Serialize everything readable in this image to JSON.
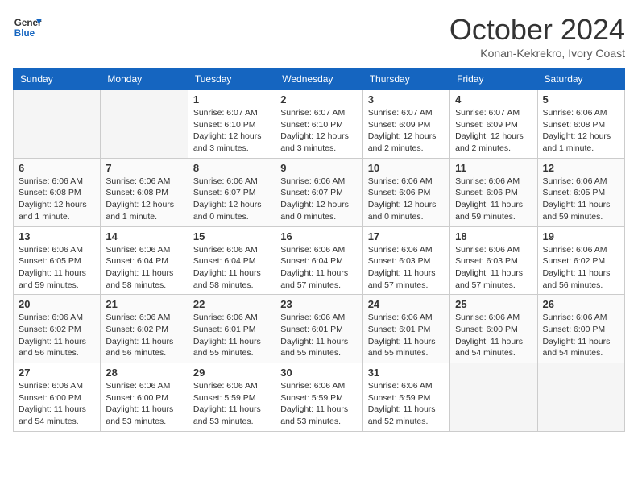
{
  "header": {
    "logo_line1": "General",
    "logo_line2": "Blue",
    "month": "October 2024",
    "location": "Konan-Kekrekro, Ivory Coast"
  },
  "weekdays": [
    "Sunday",
    "Monday",
    "Tuesday",
    "Wednesday",
    "Thursday",
    "Friday",
    "Saturday"
  ],
  "weeks": [
    [
      {
        "day": "",
        "info": ""
      },
      {
        "day": "",
        "info": ""
      },
      {
        "day": "1",
        "info": "Sunrise: 6:07 AM\nSunset: 6:10 PM\nDaylight: 12 hours and 3 minutes."
      },
      {
        "day": "2",
        "info": "Sunrise: 6:07 AM\nSunset: 6:10 PM\nDaylight: 12 hours and 3 minutes."
      },
      {
        "day": "3",
        "info": "Sunrise: 6:07 AM\nSunset: 6:09 PM\nDaylight: 12 hours and 2 minutes."
      },
      {
        "day": "4",
        "info": "Sunrise: 6:07 AM\nSunset: 6:09 PM\nDaylight: 12 hours and 2 minutes."
      },
      {
        "day": "5",
        "info": "Sunrise: 6:06 AM\nSunset: 6:08 PM\nDaylight: 12 hours and 1 minute."
      }
    ],
    [
      {
        "day": "6",
        "info": "Sunrise: 6:06 AM\nSunset: 6:08 PM\nDaylight: 12 hours and 1 minute."
      },
      {
        "day": "7",
        "info": "Sunrise: 6:06 AM\nSunset: 6:08 PM\nDaylight: 12 hours and 1 minute."
      },
      {
        "day": "8",
        "info": "Sunrise: 6:06 AM\nSunset: 6:07 PM\nDaylight: 12 hours and 0 minutes."
      },
      {
        "day": "9",
        "info": "Sunrise: 6:06 AM\nSunset: 6:07 PM\nDaylight: 12 hours and 0 minutes."
      },
      {
        "day": "10",
        "info": "Sunrise: 6:06 AM\nSunset: 6:06 PM\nDaylight: 12 hours and 0 minutes."
      },
      {
        "day": "11",
        "info": "Sunrise: 6:06 AM\nSunset: 6:06 PM\nDaylight: 11 hours and 59 minutes."
      },
      {
        "day": "12",
        "info": "Sunrise: 6:06 AM\nSunset: 6:05 PM\nDaylight: 11 hours and 59 minutes."
      }
    ],
    [
      {
        "day": "13",
        "info": "Sunrise: 6:06 AM\nSunset: 6:05 PM\nDaylight: 11 hours and 59 minutes."
      },
      {
        "day": "14",
        "info": "Sunrise: 6:06 AM\nSunset: 6:04 PM\nDaylight: 11 hours and 58 minutes."
      },
      {
        "day": "15",
        "info": "Sunrise: 6:06 AM\nSunset: 6:04 PM\nDaylight: 11 hours and 58 minutes."
      },
      {
        "day": "16",
        "info": "Sunrise: 6:06 AM\nSunset: 6:04 PM\nDaylight: 11 hours and 57 minutes."
      },
      {
        "day": "17",
        "info": "Sunrise: 6:06 AM\nSunset: 6:03 PM\nDaylight: 11 hours and 57 minutes."
      },
      {
        "day": "18",
        "info": "Sunrise: 6:06 AM\nSunset: 6:03 PM\nDaylight: 11 hours and 57 minutes."
      },
      {
        "day": "19",
        "info": "Sunrise: 6:06 AM\nSunset: 6:02 PM\nDaylight: 11 hours and 56 minutes."
      }
    ],
    [
      {
        "day": "20",
        "info": "Sunrise: 6:06 AM\nSunset: 6:02 PM\nDaylight: 11 hours and 56 minutes."
      },
      {
        "day": "21",
        "info": "Sunrise: 6:06 AM\nSunset: 6:02 PM\nDaylight: 11 hours and 56 minutes."
      },
      {
        "day": "22",
        "info": "Sunrise: 6:06 AM\nSunset: 6:01 PM\nDaylight: 11 hours and 55 minutes."
      },
      {
        "day": "23",
        "info": "Sunrise: 6:06 AM\nSunset: 6:01 PM\nDaylight: 11 hours and 55 minutes."
      },
      {
        "day": "24",
        "info": "Sunrise: 6:06 AM\nSunset: 6:01 PM\nDaylight: 11 hours and 55 minutes."
      },
      {
        "day": "25",
        "info": "Sunrise: 6:06 AM\nSunset: 6:00 PM\nDaylight: 11 hours and 54 minutes."
      },
      {
        "day": "26",
        "info": "Sunrise: 6:06 AM\nSunset: 6:00 PM\nDaylight: 11 hours and 54 minutes."
      }
    ],
    [
      {
        "day": "27",
        "info": "Sunrise: 6:06 AM\nSunset: 6:00 PM\nDaylight: 11 hours and 54 minutes."
      },
      {
        "day": "28",
        "info": "Sunrise: 6:06 AM\nSunset: 6:00 PM\nDaylight: 11 hours and 53 minutes."
      },
      {
        "day": "29",
        "info": "Sunrise: 6:06 AM\nSunset: 5:59 PM\nDaylight: 11 hours and 53 minutes."
      },
      {
        "day": "30",
        "info": "Sunrise: 6:06 AM\nSunset: 5:59 PM\nDaylight: 11 hours and 53 minutes."
      },
      {
        "day": "31",
        "info": "Sunrise: 6:06 AM\nSunset: 5:59 PM\nDaylight: 11 hours and 52 minutes."
      },
      {
        "day": "",
        "info": ""
      },
      {
        "day": "",
        "info": ""
      }
    ]
  ]
}
